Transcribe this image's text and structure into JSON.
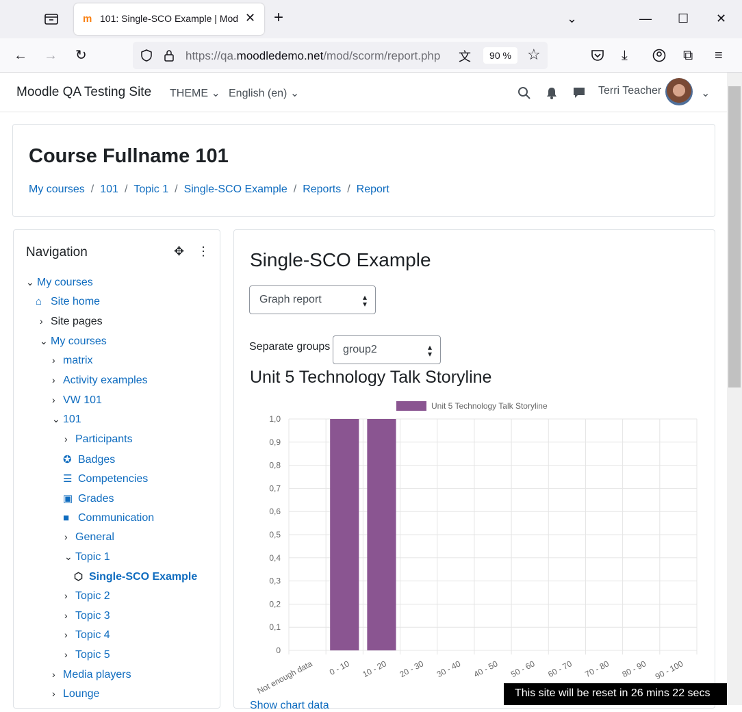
{
  "browser": {
    "tab_title": "101: Single-SCO Example | Mod",
    "url_prefix": "https://qa.",
    "url_domain": "moodledemo.net",
    "url_suffix": "/mod/scorm/report.php",
    "zoom": "90 %"
  },
  "header": {
    "site_name": "Moodle QA Testing Site",
    "theme_label": "THEME",
    "language_label": "English (en)",
    "user_name": "Terri Teacher"
  },
  "course": {
    "title": "Course Fullname 101",
    "breadcrumb": [
      "My courses",
      "101",
      "Topic 1",
      "Single-SCO Example",
      "Reports",
      "Report"
    ]
  },
  "navigation": {
    "title": "Navigation",
    "items": [
      {
        "label": "My courses"
      },
      {
        "label": "Site home"
      },
      {
        "label": "Site pages"
      },
      {
        "label": "My courses"
      },
      {
        "label": "matrix"
      },
      {
        "label": "Activity examples"
      },
      {
        "label": "VW 101"
      },
      {
        "label": "101"
      },
      {
        "label": "Participants"
      },
      {
        "label": "Badges"
      },
      {
        "label": "Competencies"
      },
      {
        "label": "Grades"
      },
      {
        "label": "Communication"
      },
      {
        "label": "General"
      },
      {
        "label": "Topic 1"
      },
      {
        "label": "Single-SCO Example"
      },
      {
        "label": "Topic 2"
      },
      {
        "label": "Topic 3"
      },
      {
        "label": "Topic 4"
      },
      {
        "label": "Topic 5"
      },
      {
        "label": "Media players"
      },
      {
        "label": "Lounge"
      }
    ]
  },
  "main": {
    "heading": "Single-SCO Example",
    "report_select": "Graph report",
    "groups_label": "Separate groups",
    "groups_select": "group2",
    "chart_heading": "Unit 5 Technology Talk Storyline",
    "show_chart_data": "Show chart data"
  },
  "chart_data": {
    "type": "bar",
    "series": [
      {
        "name": "Unit 5 Technology Talk Storyline",
        "values": [
          0,
          1,
          1,
          0,
          0,
          0,
          0,
          0,
          0,
          0,
          0
        ],
        "color": "#8a5591"
      }
    ],
    "categories": [
      "Not enough data",
      "0 - 10",
      "10 - 20",
      "20 - 30",
      "30 - 40",
      "40 - 50",
      "50 - 60",
      "60 - 70",
      "70 - 80",
      "80 - 90",
      "90 - 100"
    ],
    "y_ticks": [
      "1,0",
      "0,9",
      "0,8",
      "0,7",
      "0,6",
      "0,5",
      "0,4",
      "0,3",
      "0,2",
      "0,1",
      "0"
    ],
    "ylim": [
      0,
      1
    ],
    "grid": true,
    "legend": "top"
  },
  "footer": {
    "reset_notice": "This site will be reset in 26 mins 22 secs"
  }
}
